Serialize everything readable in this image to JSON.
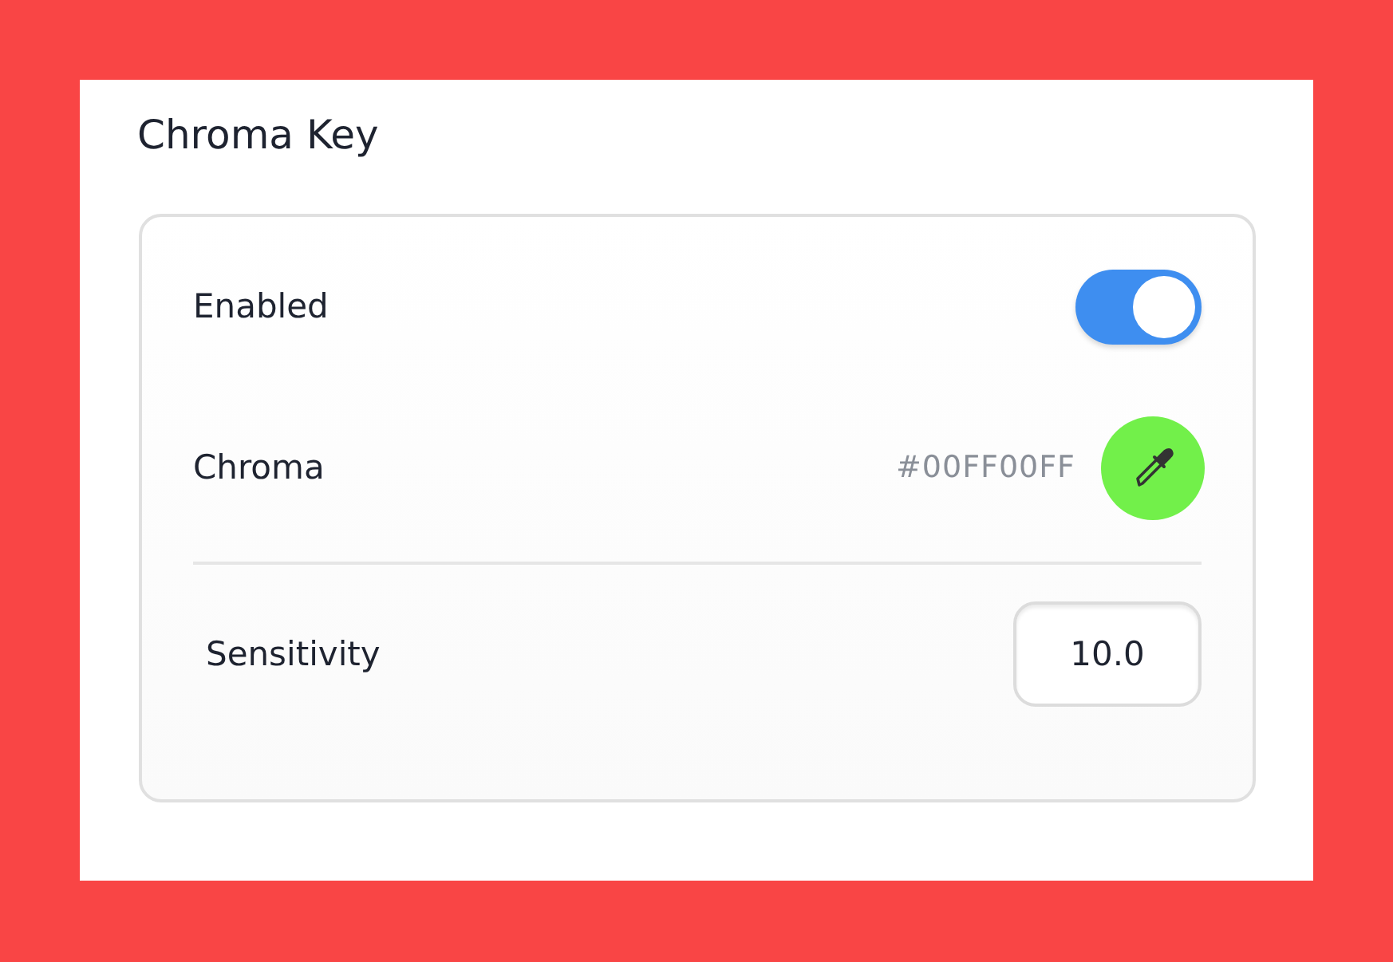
{
  "title": "Chroma Key",
  "settings": [
    {
      "kind": "toggle",
      "label": "Enabled",
      "on": true
    },
    {
      "kind": "color",
      "label": "Chroma",
      "value": "#00FF00FF"
    },
    {
      "kind": "divider"
    },
    {
      "kind": "number",
      "label": "Sensitivity",
      "value": "10.0"
    }
  ]
}
